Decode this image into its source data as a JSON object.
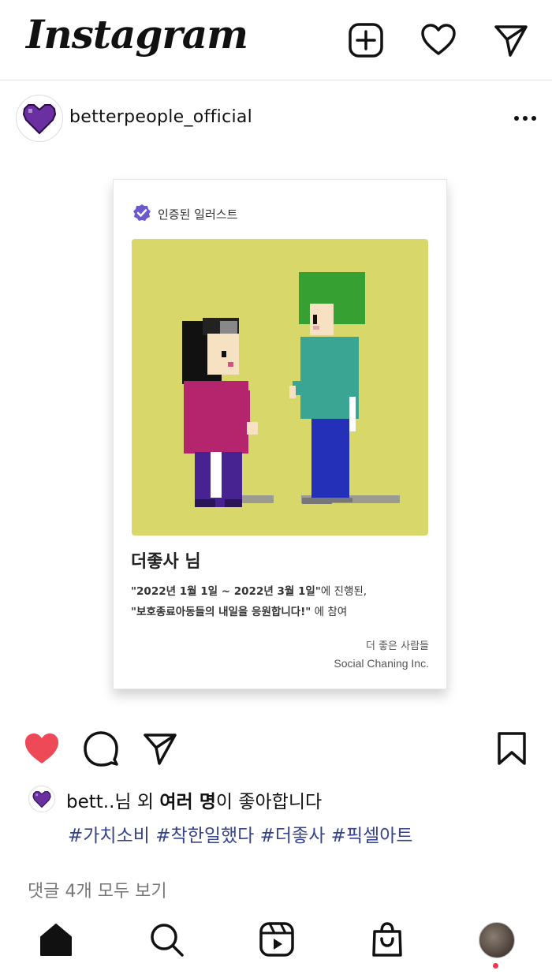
{
  "app": {
    "name": "Instagram"
  },
  "topbar": {
    "icons": [
      "new-post-icon",
      "heart-icon",
      "direct-message-icon"
    ]
  },
  "post": {
    "username": "betterpeople_official",
    "card": {
      "verified_label": "인증된 일러스트",
      "title": "더좋사 님",
      "line1_bold": "\"2022년 1월 1일 ~ 2022년 3월 1일\"",
      "line1_rest": "에 진행된,",
      "line2_bold": "\"보호종료아동들의 내일을 응원합니다!\"",
      "line2_rest": " 에 참여",
      "org_kr": "더 좋은 사람들",
      "org_en": "Social Chaning Inc.",
      "art_bg_color": "#d8d769"
    },
    "likes": {
      "prefix": "bett..",
      "middle": "님 외 ",
      "bold": "여러 명",
      "suffix": "이 좋아합니다"
    },
    "hashtags": "#가치소비 #착한일했다 #더좋사 #픽셀아트",
    "comments_link": "댓글 4개 모두 보기",
    "liked": true,
    "like_color": "#ed4956"
  },
  "nav": {
    "items": [
      "home-icon",
      "search-icon",
      "reels-icon",
      "shop-icon",
      "profile-avatar"
    ],
    "notification_color": "#ee3a4e"
  }
}
